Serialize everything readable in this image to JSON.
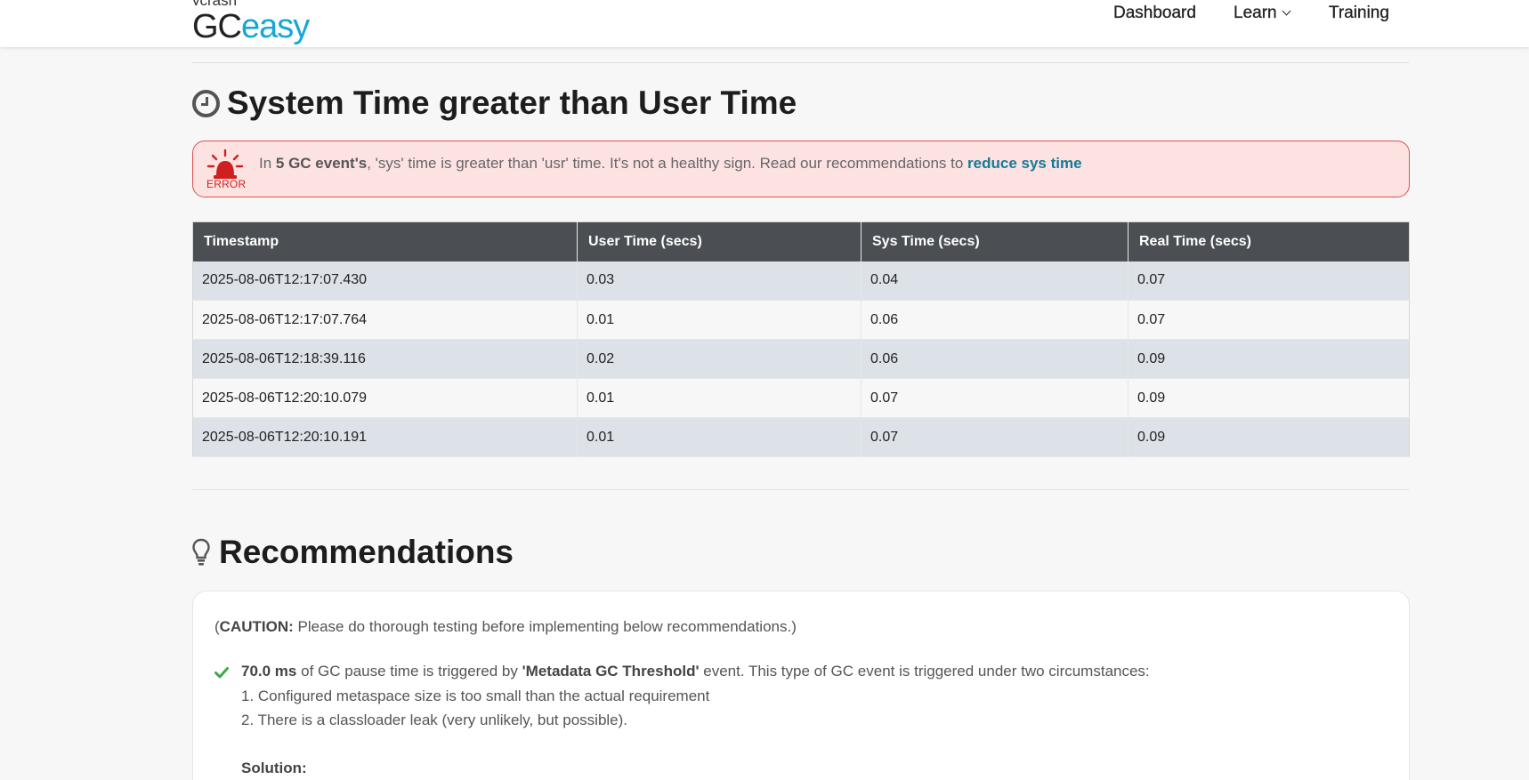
{
  "header": {
    "logo_small": "ycrash",
    "logo_black": "GC",
    "logo_blue": "easy",
    "nav": {
      "dashboard": "Dashboard",
      "learn": "Learn",
      "training": "Training"
    }
  },
  "sys_time_section": {
    "title": "System Time greater than User Time",
    "alert": {
      "label": "ERROR",
      "prefix": "In ",
      "count_bold": "5 GC event's",
      "middle": ", 'sys' time is greater than 'usr' time. It's not a healthy sign. Read our recommendations to ",
      "link_text": "reduce sys time"
    },
    "table": {
      "headers": [
        "Timestamp",
        "User Time (secs)",
        "Sys Time (secs)",
        "Real Time (secs)"
      ],
      "rows": [
        [
          "2025-08-06T12:17:07.430",
          "0.03",
          "0.04",
          "0.07"
        ],
        [
          "2025-08-06T12:17:07.764",
          "0.01",
          "0.06",
          "0.07"
        ],
        [
          "2025-08-06T12:18:39.116",
          "0.02",
          "0.06",
          "0.09"
        ],
        [
          "2025-08-06T12:20:10.079",
          "0.01",
          "0.07",
          "0.09"
        ],
        [
          "2025-08-06T12:20:10.191",
          "0.01",
          "0.07",
          "0.09"
        ]
      ]
    }
  },
  "recommendations": {
    "title": "Recommendations",
    "caution_open": "(",
    "caution_bold": "CAUTION:",
    "caution_rest": " Please do thorough testing before implementing below recommendations.)",
    "item": {
      "time_bold": "70.0 ms",
      "text1": " of GC pause time is triggered by ",
      "cause_bold": "'Metadata GC Threshold'",
      "text2": " event. This type of GC event is triggered under two circumstances:",
      "point1": "1. Configured metaspace size is too small than the actual requirement",
      "point2": "2. There is a classloader leak (very unlikely, but possible).",
      "solution": "Solution:"
    }
  },
  "colors": {
    "brand_blue": "#16a6d8",
    "table_header": "#4b4e53",
    "alert_bg": "#fde2e2",
    "alert_border": "#e05050",
    "error_red": "#d11f1f",
    "link": "#147a96",
    "check_green": "#3aaa4a"
  }
}
